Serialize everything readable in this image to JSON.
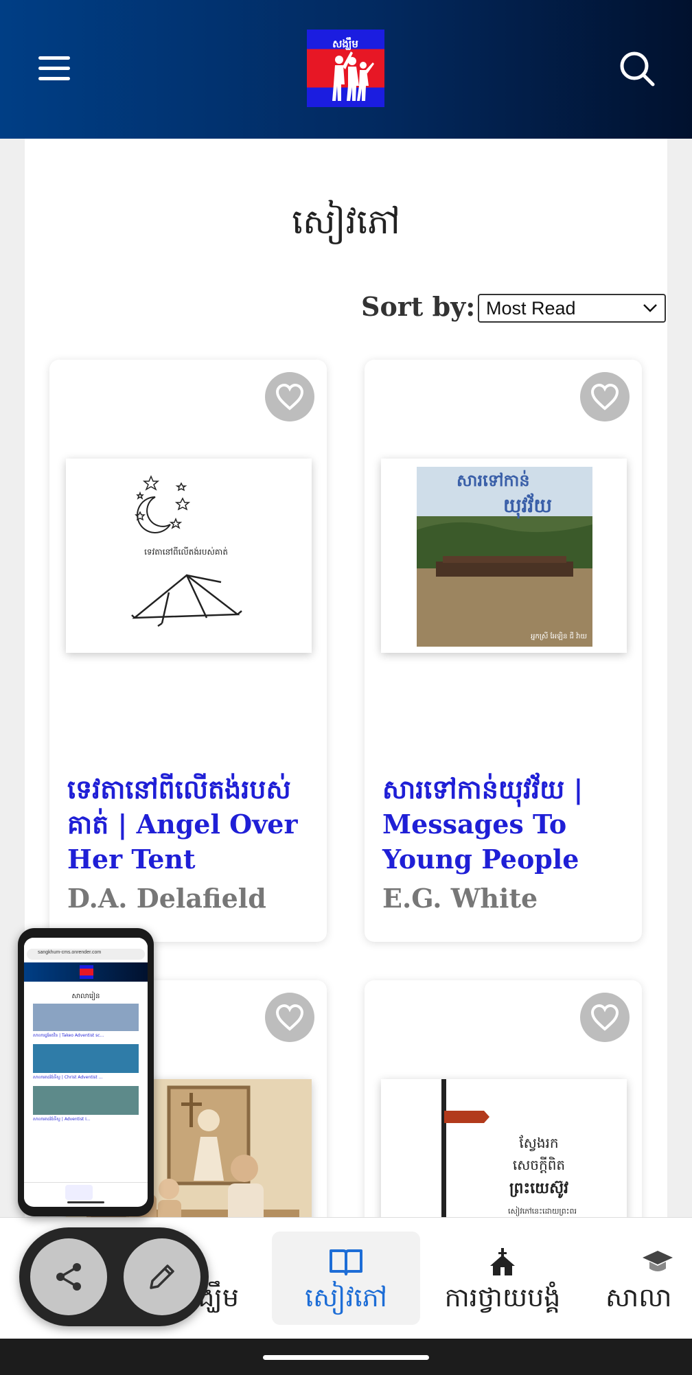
{
  "header": {
    "menu_icon": "hamburger-menu-icon",
    "search_icon": "search-icon",
    "logo_icon": "flag-logo-icon",
    "logo_text": "សង្ឃឹម"
  },
  "page": {
    "title": "សៀវភៅ"
  },
  "sort": {
    "label": "Sort by:",
    "selected": "Most Read"
  },
  "books": [
    {
      "title": "ទេវតានៅពីលើតង់របស់គាត់ | Angel Over Her Tent",
      "author": "D.A. Delafield",
      "cover_text": "ទេវតានៅពីលើតង់របស់គាត់"
    },
    {
      "title": "សារទៅកាន់យុវវ័យ | Messages To Young People",
      "author": "E.G. White",
      "cover_text_1": "សារទៅកាន់",
      "cover_text_2": "យុវវ័យ",
      "cover_footer": "អ្នកស្រី អែឡិន ជី វ៉ាយ"
    },
    {
      "title": "",
      "author": ""
    },
    {
      "title": "",
      "author": "",
      "cover_text_1": "ស្វែងរក",
      "cover_text_2": "សេចក្ដីពិត",
      "cover_text_3": "ព្រះយេស៊ូវ",
      "cover_text_4": "សៀវភៅនេះដោយព្រះពរ"
    }
  ],
  "bottom_nav": [
    {
      "label": "សង្ឃឹម",
      "icon": "hope-icon"
    },
    {
      "label": "សៀវភៅ",
      "icon": "book-open-icon",
      "active": true
    },
    {
      "label": "ការថ្វាយបង្គំ",
      "icon": "church-icon"
    },
    {
      "label": "សាលា",
      "icon": "graduation-cap-icon"
    }
  ],
  "fabs": {
    "share_icon": "share-icon",
    "edit_icon": "pencil-icon"
  },
  "mini_preview": {
    "url": "sangkhum-cms.onrender.com",
    "title": "សាលារៀន",
    "items": [
      "សាលារដ្ឋអែតវិន | Takeo Adventist sc...",
      "សាលាអាដវ៉ង់ទីស្ទ | Christ Adventist ...",
      "សាលាអាដវ៉ង់ទីស្ទ | Adventist I..."
    ]
  }
}
